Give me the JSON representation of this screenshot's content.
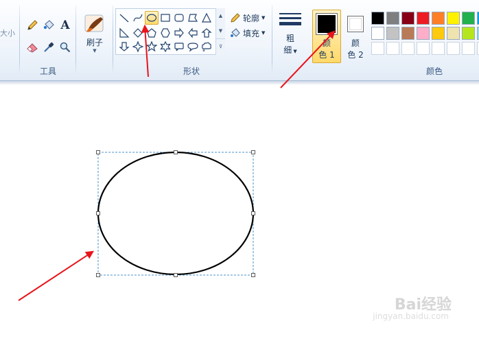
{
  "ribbon": {
    "size_label": "大小",
    "tools_label": "工具",
    "brush_label": "刷子",
    "shapes_label": "形状",
    "outline_label": "轮廓",
    "fill_label": "填充",
    "thickness_label_1": "粗",
    "thickness_label_2": "细",
    "color1_label_1": "颜",
    "color1_label_2": "色 1",
    "color2_label_1": "颜",
    "color2_label_2": "色 2",
    "colors_label": "颜色",
    "tool_text_glyph": "A"
  },
  "colors": {
    "color1": "#000000",
    "color2": "#ffffff",
    "palette": [
      [
        "#000000",
        "#7f7f7f",
        "#880015",
        "#ed1c24",
        "#ff7f27",
        "#fff200",
        "#22b14c",
        "#00a2e8"
      ],
      [
        "#ffffff",
        "#c3c3c3",
        "#b97a57",
        "#ffaec9",
        "#ffc90e",
        "#efe4b0",
        "#b5e61d",
        "#99d9ea"
      ],
      [
        "#ffffff",
        "#ffffff",
        "#ffffff",
        "#ffffff",
        "#ffffff",
        "#ffffff",
        "#ffffff",
        "#ffffff"
      ]
    ],
    "arrow_color": "#e8141b"
  },
  "shapes": {
    "selected": "ellipse-shape",
    "items": [
      "line",
      "curve",
      "ellipse",
      "rectangle",
      "rounded-rectangle",
      "polygon",
      "triangle",
      "right-triangle",
      "diamond",
      "pentagon",
      "hexagon",
      "arrow-right",
      "arrow-left",
      "arrow-up",
      "arrow-down",
      "star-four",
      "star-five",
      "star-six",
      "callout-rounded",
      "callout-oval",
      "callout-cloud"
    ]
  },
  "watermark": {
    "brand": "Bai经验",
    "url": "jingyan.baidu.com"
  }
}
